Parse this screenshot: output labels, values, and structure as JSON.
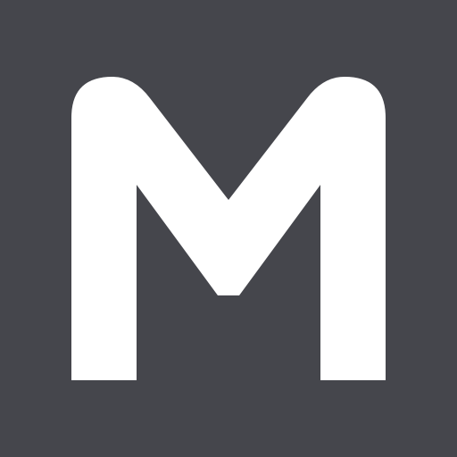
{
  "icon": {
    "semantic_name": "letter-m-logo-icon",
    "letter": "M",
    "background_color": "#45464c",
    "glyph_color": "#ffffff"
  }
}
